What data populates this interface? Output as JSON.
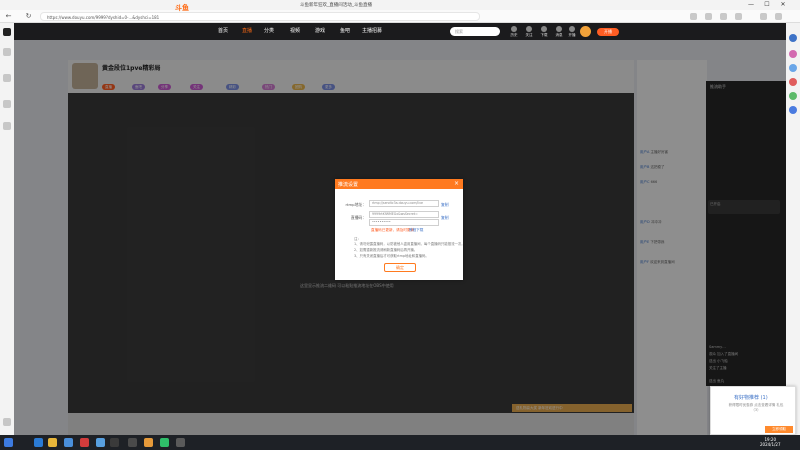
{
  "browser": {
    "window_title": "斗鱼新年狂欢_直播间活动_斗鱼直播",
    "url": "https://www.douyu.com/9999?dyshid=0-...&dyshci=181",
    "minimize": "—",
    "maximize": "☐",
    "close": "✕",
    "back": "←",
    "refresh": "↻"
  },
  "site": {
    "logo": "斗鱼",
    "nav": [
      "首页",
      "直播",
      "分类",
      "视频",
      "游戏",
      "鱼吧",
      "主播招募"
    ],
    "search_placeholder": "搜索",
    "header_icons": [
      "历史",
      "关注",
      "下载",
      "消息",
      "开播"
    ],
    "live_button": "开播"
  },
  "streamer": {
    "title": "黄金段位1pve精彩局",
    "tags": [
      "直播",
      "鱼吧",
      "分享",
      "关注",
      "精彩",
      "热门",
      "团购",
      "更多"
    ]
  },
  "player": {
    "note": "这里显示推流二维码 可以粘贴推流地址在OBS中使用"
  },
  "modal": {
    "title": "推流设置",
    "close": "×",
    "rtmp_label": "rtmp地址：",
    "rtmp_value": "rtmp://sendtc3a.douyu.com/live",
    "rtmp_copy": "复制",
    "key_label": "直播码：",
    "key_value": "9999rtKfWMEGx&wsSecret=",
    "key_copy": "复制",
    "key_masked": "••••••••••",
    "warning": "直播码已更新，请及时更换",
    "help_link": "教程下载",
    "notes_header": "注：",
    "notes": [
      "1、请勿泄露直播码，以防被他人盗用直播间，每个直播码只能推流一次。",
      "2、如需重新推流请刷新直播码后再开播。",
      "3、只有关闭直播后才可获取rtmp地址和直播码。"
    ],
    "ok_button": "确定"
  },
  "gift_banner": "送礼物赢大奖 新年狂欢进行中",
  "float_panel": {
    "title": "推流助手",
    "pill_text": "已开启",
    "lines": [
      "Sammy…",
      "观众 加入了直播间",
      "送出 小飞船",
      "关注了主播",
      "送出 鱼丸"
    ]
  },
  "chat": {
    "lines": [
      {
        "user": "用户A",
        "text": "主播好厉害"
      },
      {
        "user": "用户B",
        "text": "这把稳了"
      },
      {
        "user": "用户C",
        "text": "666"
      },
      {
        "user": "用户D",
        "text": "冲冲冲"
      },
      {
        "user": "用户E",
        "text": "下把带我"
      },
      {
        "user": "用户F",
        "text": "欢迎来到直播间"
      }
    ]
  },
  "toast": {
    "title": "有好物推荐 (1)",
    "body": "获得限时优惠券 点击查看详情 礼包（3）",
    "button": "立即领取"
  },
  "taskbar": {
    "time": "19:20",
    "date": "2024/1/27"
  },
  "colors": {
    "brand_orange": "#ff7a1f",
    "header_dark": "#1b1b1d",
    "link_blue": "#3e73c7"
  }
}
